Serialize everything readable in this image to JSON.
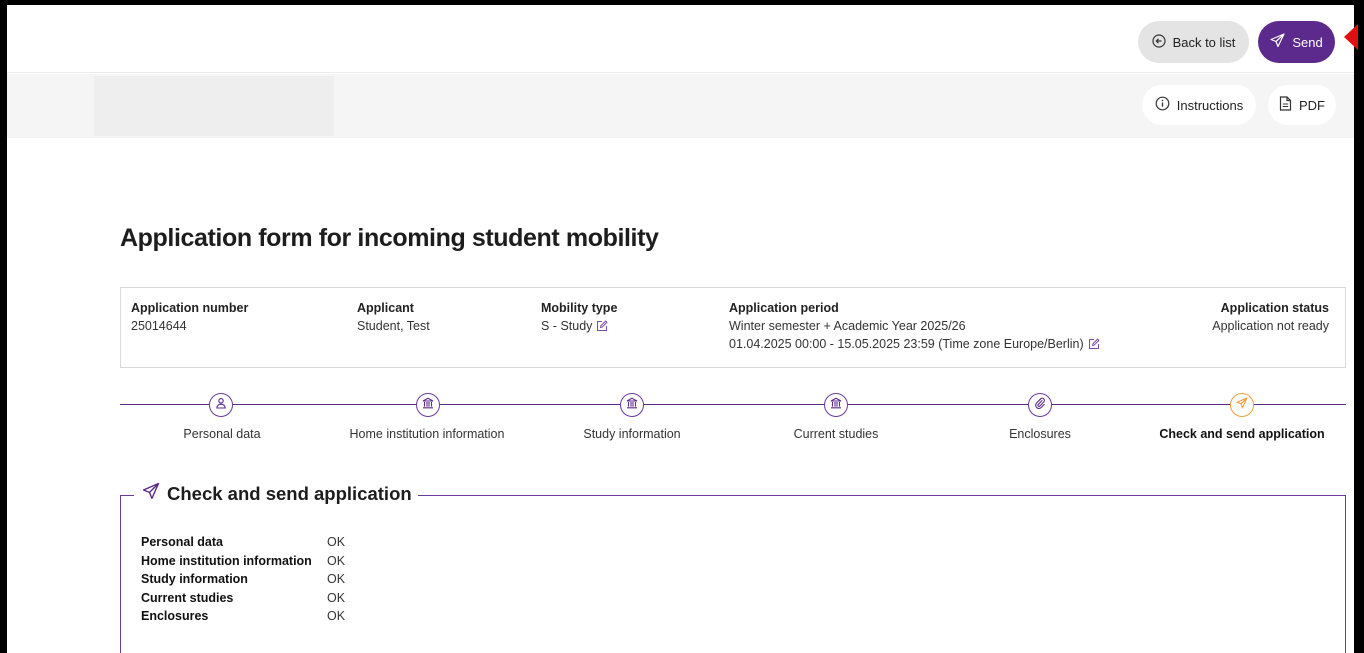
{
  "toolbar": {
    "back_label": "Back to list",
    "send_label": "Send",
    "instructions_label": "Instructions",
    "pdf_label": "PDF"
  },
  "page": {
    "title": "Application form for incoming student mobility"
  },
  "info": {
    "application_number": {
      "label": "Application number",
      "value": "25014644"
    },
    "applicant": {
      "label": "Applicant",
      "value": "Student, Test"
    },
    "mobility_type": {
      "label": "Mobility type",
      "value": "S - Study"
    },
    "application_period": {
      "label": "Application period",
      "value_line1": "Winter semester + Academic Year 2025/26",
      "value_line2": "01.04.2025 00:00 - 15.05.2025 23:59 (Time zone Europe/Berlin)"
    },
    "application_status": {
      "label": "Application status",
      "value": "Application not ready"
    }
  },
  "steps": [
    {
      "label": "Personal data",
      "icon": "person-icon"
    },
    {
      "label": "Home institution information",
      "icon": "institution-icon"
    },
    {
      "label": "Study information",
      "icon": "institution-icon"
    },
    {
      "label": "Current studies",
      "icon": "institution-icon"
    },
    {
      "label": "Enclosures",
      "icon": "paperclip-icon"
    },
    {
      "label": "Check and send application",
      "icon": "send-icon",
      "active": true
    }
  ],
  "check_section": {
    "title": "Check and send application",
    "rows": [
      {
        "label": "Personal data",
        "status": "OK"
      },
      {
        "label": "Home institution information",
        "status": "OK"
      },
      {
        "label": "Study information",
        "status": "OK"
      },
      {
        "label": "Current studies",
        "status": "OK"
      },
      {
        "label": "Enclosures",
        "status": "OK"
      }
    ]
  },
  "colors": {
    "accent": "#5b2a8c",
    "active_step": "#f0a040",
    "annotation_arrow": "#e10e0e"
  }
}
